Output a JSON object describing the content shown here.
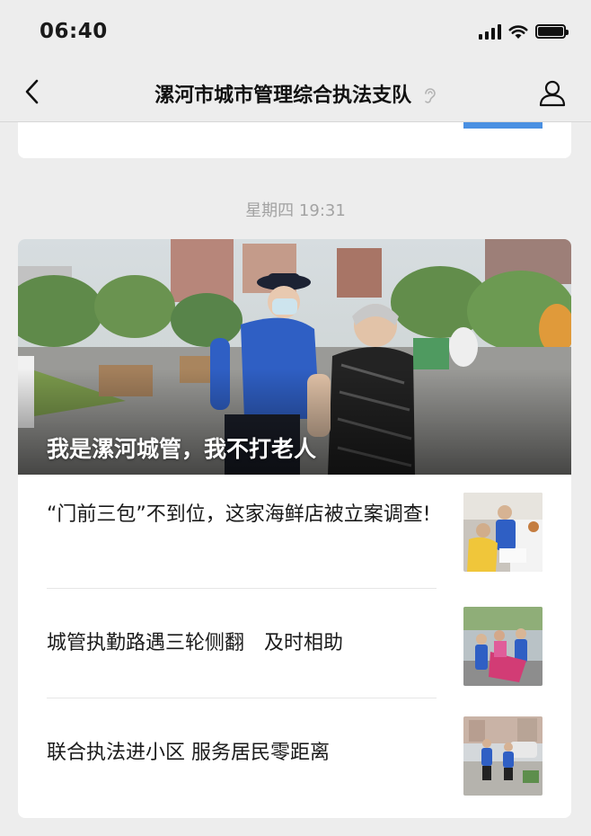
{
  "status_bar": {
    "time": "06:40"
  },
  "nav": {
    "title": "漯河市城市管理综合执法支队"
  },
  "timestamp": "星期四 19:31",
  "hero": {
    "title": "我是漯河城管，我不打老人"
  },
  "articles": [
    {
      "title": "“门前三包”不到位，这家海鲜店被立案调查!"
    },
    {
      "title": "城管执勤路遇三轮侧翻　及时相助"
    },
    {
      "title": "联合执法进小区 服务居民零距离"
    }
  ],
  "colors": {
    "background": "#ededed",
    "card": "#ffffff",
    "timestamp": "#a3a3a3",
    "uniform_blue": "#2f5fc4"
  }
}
